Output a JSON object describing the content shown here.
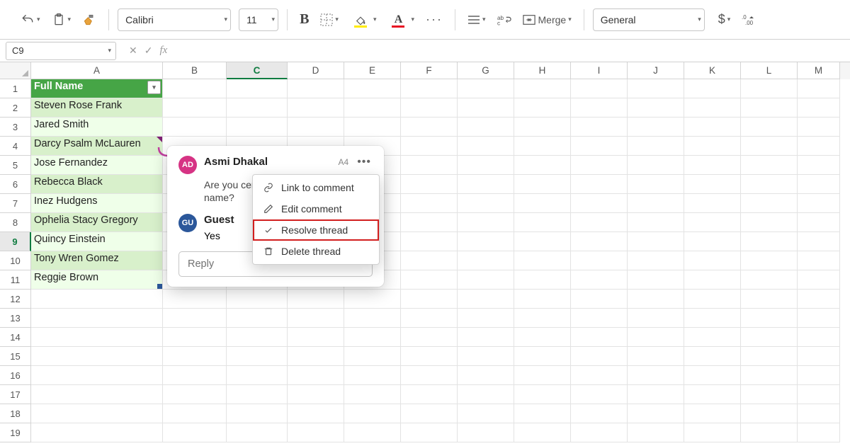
{
  "ribbon": {
    "font": "Calibri",
    "size": "11",
    "merge_label": "Merge",
    "format": "General"
  },
  "namebox": {
    "cell": "C9"
  },
  "columns": [
    "A",
    "B",
    "C",
    "D",
    "E",
    "F",
    "G",
    "H",
    "I",
    "J",
    "K",
    "L",
    "M"
  ],
  "header_label": "Full Name",
  "names": [
    "Steven Rose Frank",
    "Jared  Smith",
    "Darcy Psalm McLauren",
    "Jose  Fernandez",
    "Rebecca  Black",
    "Inez  Hudgens",
    "Ophelia Stacy Gregory",
    "Quincy  Einstein",
    "Tony Wren Gomez",
    "Reggie  Brown"
  ],
  "comment": {
    "author1": "Asmi Dhakal",
    "avatar1": "AD",
    "cell_ref": "A4",
    "body1a": "Are you cert",
    "body1b": "name?",
    "author2": "Guest",
    "avatar2": "GU",
    "body2": "Yes",
    "reply_placeholder": "Reply"
  },
  "ctx": {
    "link": "Link to comment",
    "edit": "Edit comment",
    "resolve": "Resolve thread",
    "delete": "Delete thread"
  }
}
